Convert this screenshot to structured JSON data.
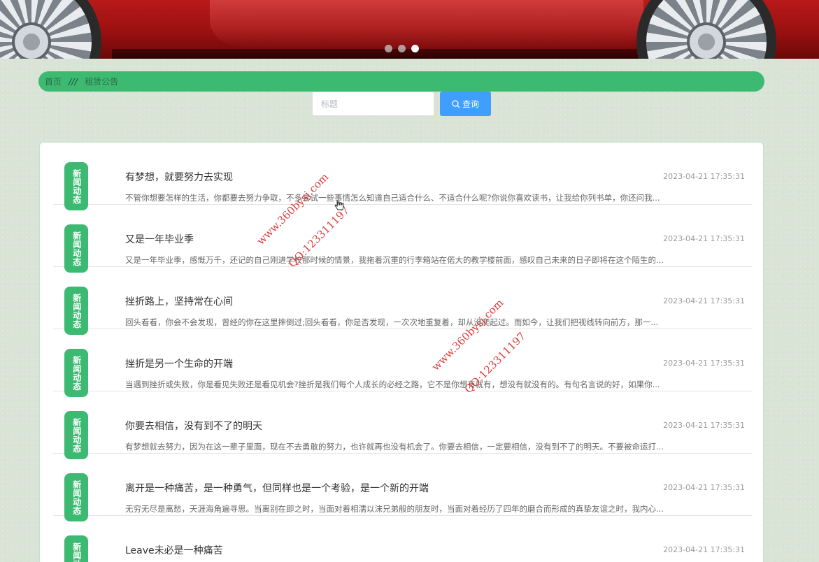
{
  "banner": {
    "slides": 3,
    "active_slide": 3
  },
  "breadcrumb": {
    "home": "首页",
    "separator": "///",
    "current": "租赁公告"
  },
  "search": {
    "placeholder": "标题",
    "button_label": "查询"
  },
  "news": {
    "badge_label": "新闻动态",
    "items": [
      {
        "title": "有梦想，就要努力去实现",
        "date": "2023-04-21 17:35:31",
        "summary": "不管你想要怎样的生活，你都要去努力争取，不多尝试一些事情怎么知道自己适合什么、不适合什么呢?你说你喜欢读书，让我给你列书单，你还问我..."
      },
      {
        "title": "又是一年毕业季",
        "date": "2023-04-21 17:35:31",
        "summary": "又是一年毕业季，感慨万千，还记的自己刚进学校那时候的情景，我拖着沉重的行李箱站在偌大的教学楼前面，感叹自己未来的日子即将在这个陌生的..."
      },
      {
        "title": "挫折路上，坚持常在心间",
        "date": "2023-04-21 17:35:31",
        "summary": "回头看看，你会不会发现，曾经的你在这里摔倒过;回头看看，你是否发现，一次次地重复着，却从没爬起过。而如今，让我们把视线转向前方，那一..."
      },
      {
        "title": "挫折是另一个生命的开端",
        "date": "2023-04-21 17:35:31",
        "summary": "当遇到挫折或失败，你是看见失败还是看见机会?挫折是我们每个人成长的必经之路，它不是你想有就有，想没有就没有的。有句名言说的好，如果你..."
      },
      {
        "title": "你要去相信，没有到不了的明天",
        "date": "2023-04-21 17:35:31",
        "summary": "有梦想就去努力，因为在这一辈子里面，现在不去勇敢的努力，也许就再也没有机会了。你要去相信，一定要相信，没有到不了的明天。不要被命运打..."
      },
      {
        "title": "离开是一种痛苦，是一种勇气，但同样也是一个考验，是一个新的开端",
        "date": "2023-04-21 17:35:31",
        "summary": "无穷无尽是离愁，天涯海角遍寻思。当离别在即之时，当面对着相濡以沫兄弟般的朋友时，当面对着经历了四年的磨合而形成的真挚友谊之时，我内心..."
      },
      {
        "title": "Leave未必是一种痛苦",
        "date": "2023-04-21 17:35:31",
        "summary": ""
      }
    ]
  },
  "watermark": {
    "site": "www.360bysj.com",
    "qq": "QQ:123311197"
  },
  "colors": {
    "accent_green": "#3dba72",
    "primary_blue": "#409eff"
  }
}
